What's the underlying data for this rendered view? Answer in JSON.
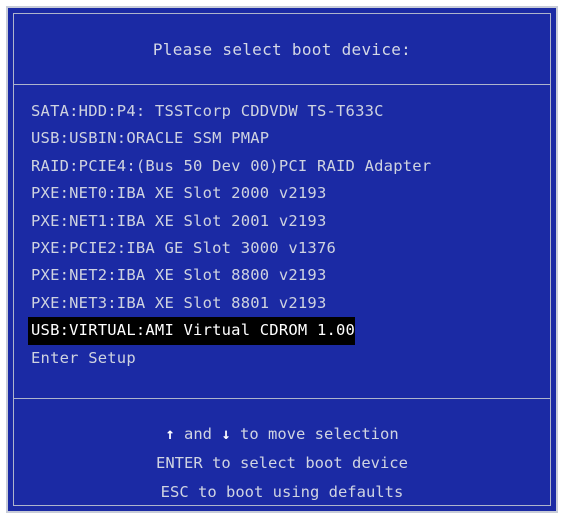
{
  "dialog": {
    "title": "Please select boot device:"
  },
  "menu": {
    "items": [
      {
        "label": "SATA:HDD:P4: TSSTcorp CDDVDW TS-T633C",
        "selected": false
      },
      {
        "label": "USB:USBIN:ORACLE SSM PMAP",
        "selected": false
      },
      {
        "label": "RAID:PCIE4:(Bus 50 Dev 00)PCI RAID Adapter",
        "selected": false
      },
      {
        "label": "PXE:NET0:IBA XE Slot 2000 v2193",
        "selected": false
      },
      {
        "label": "PXE:NET1:IBA XE Slot 2001 v2193",
        "selected": false
      },
      {
        "label": "PXE:PCIE2:IBA GE Slot 3000 v1376",
        "selected": false
      },
      {
        "label": "PXE:NET2:IBA XE Slot 8800 v2193",
        "selected": false
      },
      {
        "label": "PXE:NET3:IBA XE Slot 8801 v2193",
        "selected": false
      },
      {
        "label": "USB:VIRTUAL:AMI Virtual CDROM 1.00",
        "selected": true
      },
      {
        "label": "Enter Setup",
        "selected": false
      }
    ]
  },
  "help": {
    "arrow_up": "↑",
    "arrow_down": "↓",
    "and_text": " and ",
    "move_text": " to move selection",
    "line2": "ENTER to select boot device",
    "line3": "ESC to boot using defaults"
  },
  "colors": {
    "background": "#1b2aa4",
    "text": "#cfd3e0",
    "selected_bg": "#000000",
    "selected_text": "#ffffff",
    "border": "#c8ccd8"
  }
}
